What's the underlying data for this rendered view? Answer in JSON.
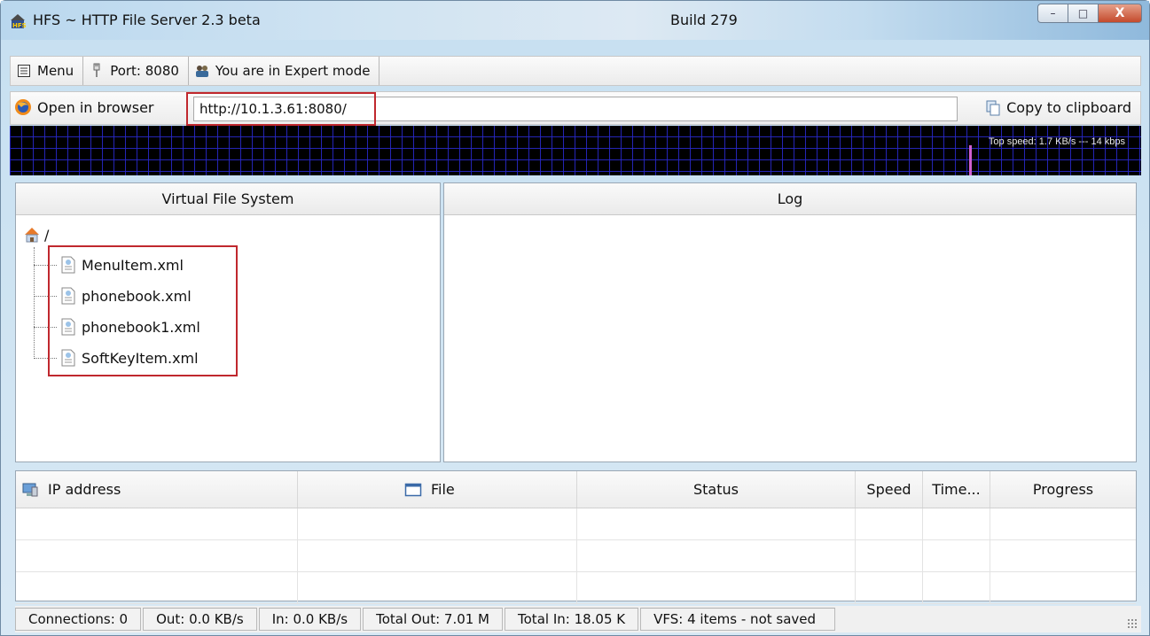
{
  "window": {
    "title": "HFS ~ HTTP File Server 2.3 beta",
    "build": "Build 279",
    "controls": {
      "minimize": "–",
      "maximize": "□",
      "close": "X"
    }
  },
  "toolbar": {
    "menu_label": "Menu",
    "port_label": "Port: 8080",
    "mode_label": "You are in Expert mode"
  },
  "urlbar": {
    "open_label": "Open in browser",
    "url": "http://10.1.3.61:8080/",
    "copy_label": "Copy to clipboard"
  },
  "graph": {
    "label": "Top speed: 1.7 KB/s  ---  14 kbps"
  },
  "vfs": {
    "header": "Virtual File System",
    "root": "/",
    "files": [
      "MenuItem.xml",
      "phonebook.xml",
      "phonebook1.xml",
      "SoftKeyItem.xml"
    ]
  },
  "log": {
    "header": "Log"
  },
  "connections": {
    "columns": [
      "IP address",
      "File",
      "Status",
      "Speed",
      "Time...",
      "Progress"
    ],
    "rows": [
      [],
      [],
      []
    ]
  },
  "statusbar": {
    "connections": "Connections: 0",
    "out": "Out: 0.0 KB/s",
    "in": "In: 0.0 KB/s",
    "total_out": "Total Out: 7.01 M",
    "total_in": "Total In: 18.05 K",
    "vfs": "VFS: 4 items - not saved"
  },
  "colors": {
    "highlight": "#c0282e",
    "graph_bg": "#000000",
    "graph_grid": "#2828c8"
  },
  "icons": [
    "hfs-app-icon",
    "menu-icon",
    "port-icon",
    "expert-mode-icon",
    "browser-icon",
    "clipboard-icon",
    "home-icon",
    "xml-file-icon",
    "computer-icon",
    "file-window-icon"
  ]
}
